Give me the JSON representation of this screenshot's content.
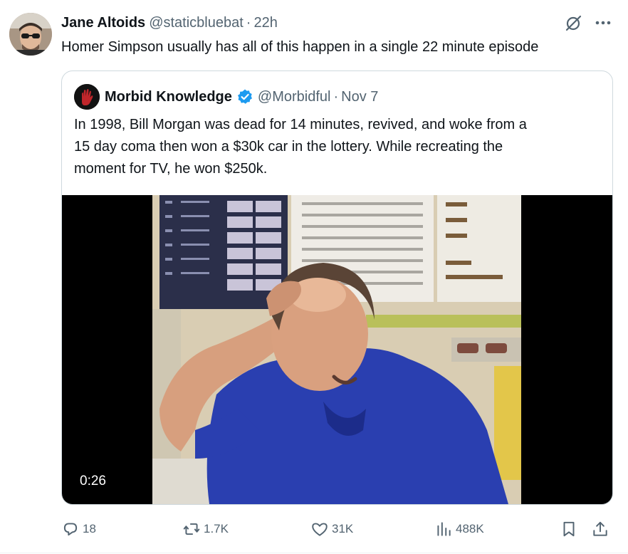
{
  "tweet": {
    "author_name": "Jane Altoids",
    "author_handle": "@staticbluebat",
    "separator": "·",
    "time": "22h",
    "text": "Homer Simpson usually has all of this happen in a single 22 minute episode"
  },
  "quote": {
    "author_name": "Morbid Knowledge",
    "author_handle": "@Morbidful",
    "separator": "·",
    "date": "Nov 7",
    "verified_icon": "verified-badge-icon",
    "text_lines": [
      "In 1998, Bill Morgan was dead for 14 minutes, revived, and woke from a",
      "15 day coma then won a $30k car in the lottery. While recreating the",
      "moment for TV, he won $250k."
    ],
    "video": {
      "duration": "0:26"
    }
  },
  "actions": {
    "replies": "18",
    "reposts": "1.7K",
    "likes": "31K",
    "views": "488K"
  },
  "colors": {
    "text_primary": "#0f1419",
    "text_secondary": "#536471",
    "border": "#cfd9de",
    "verified_blue": "#1d9bf0"
  }
}
